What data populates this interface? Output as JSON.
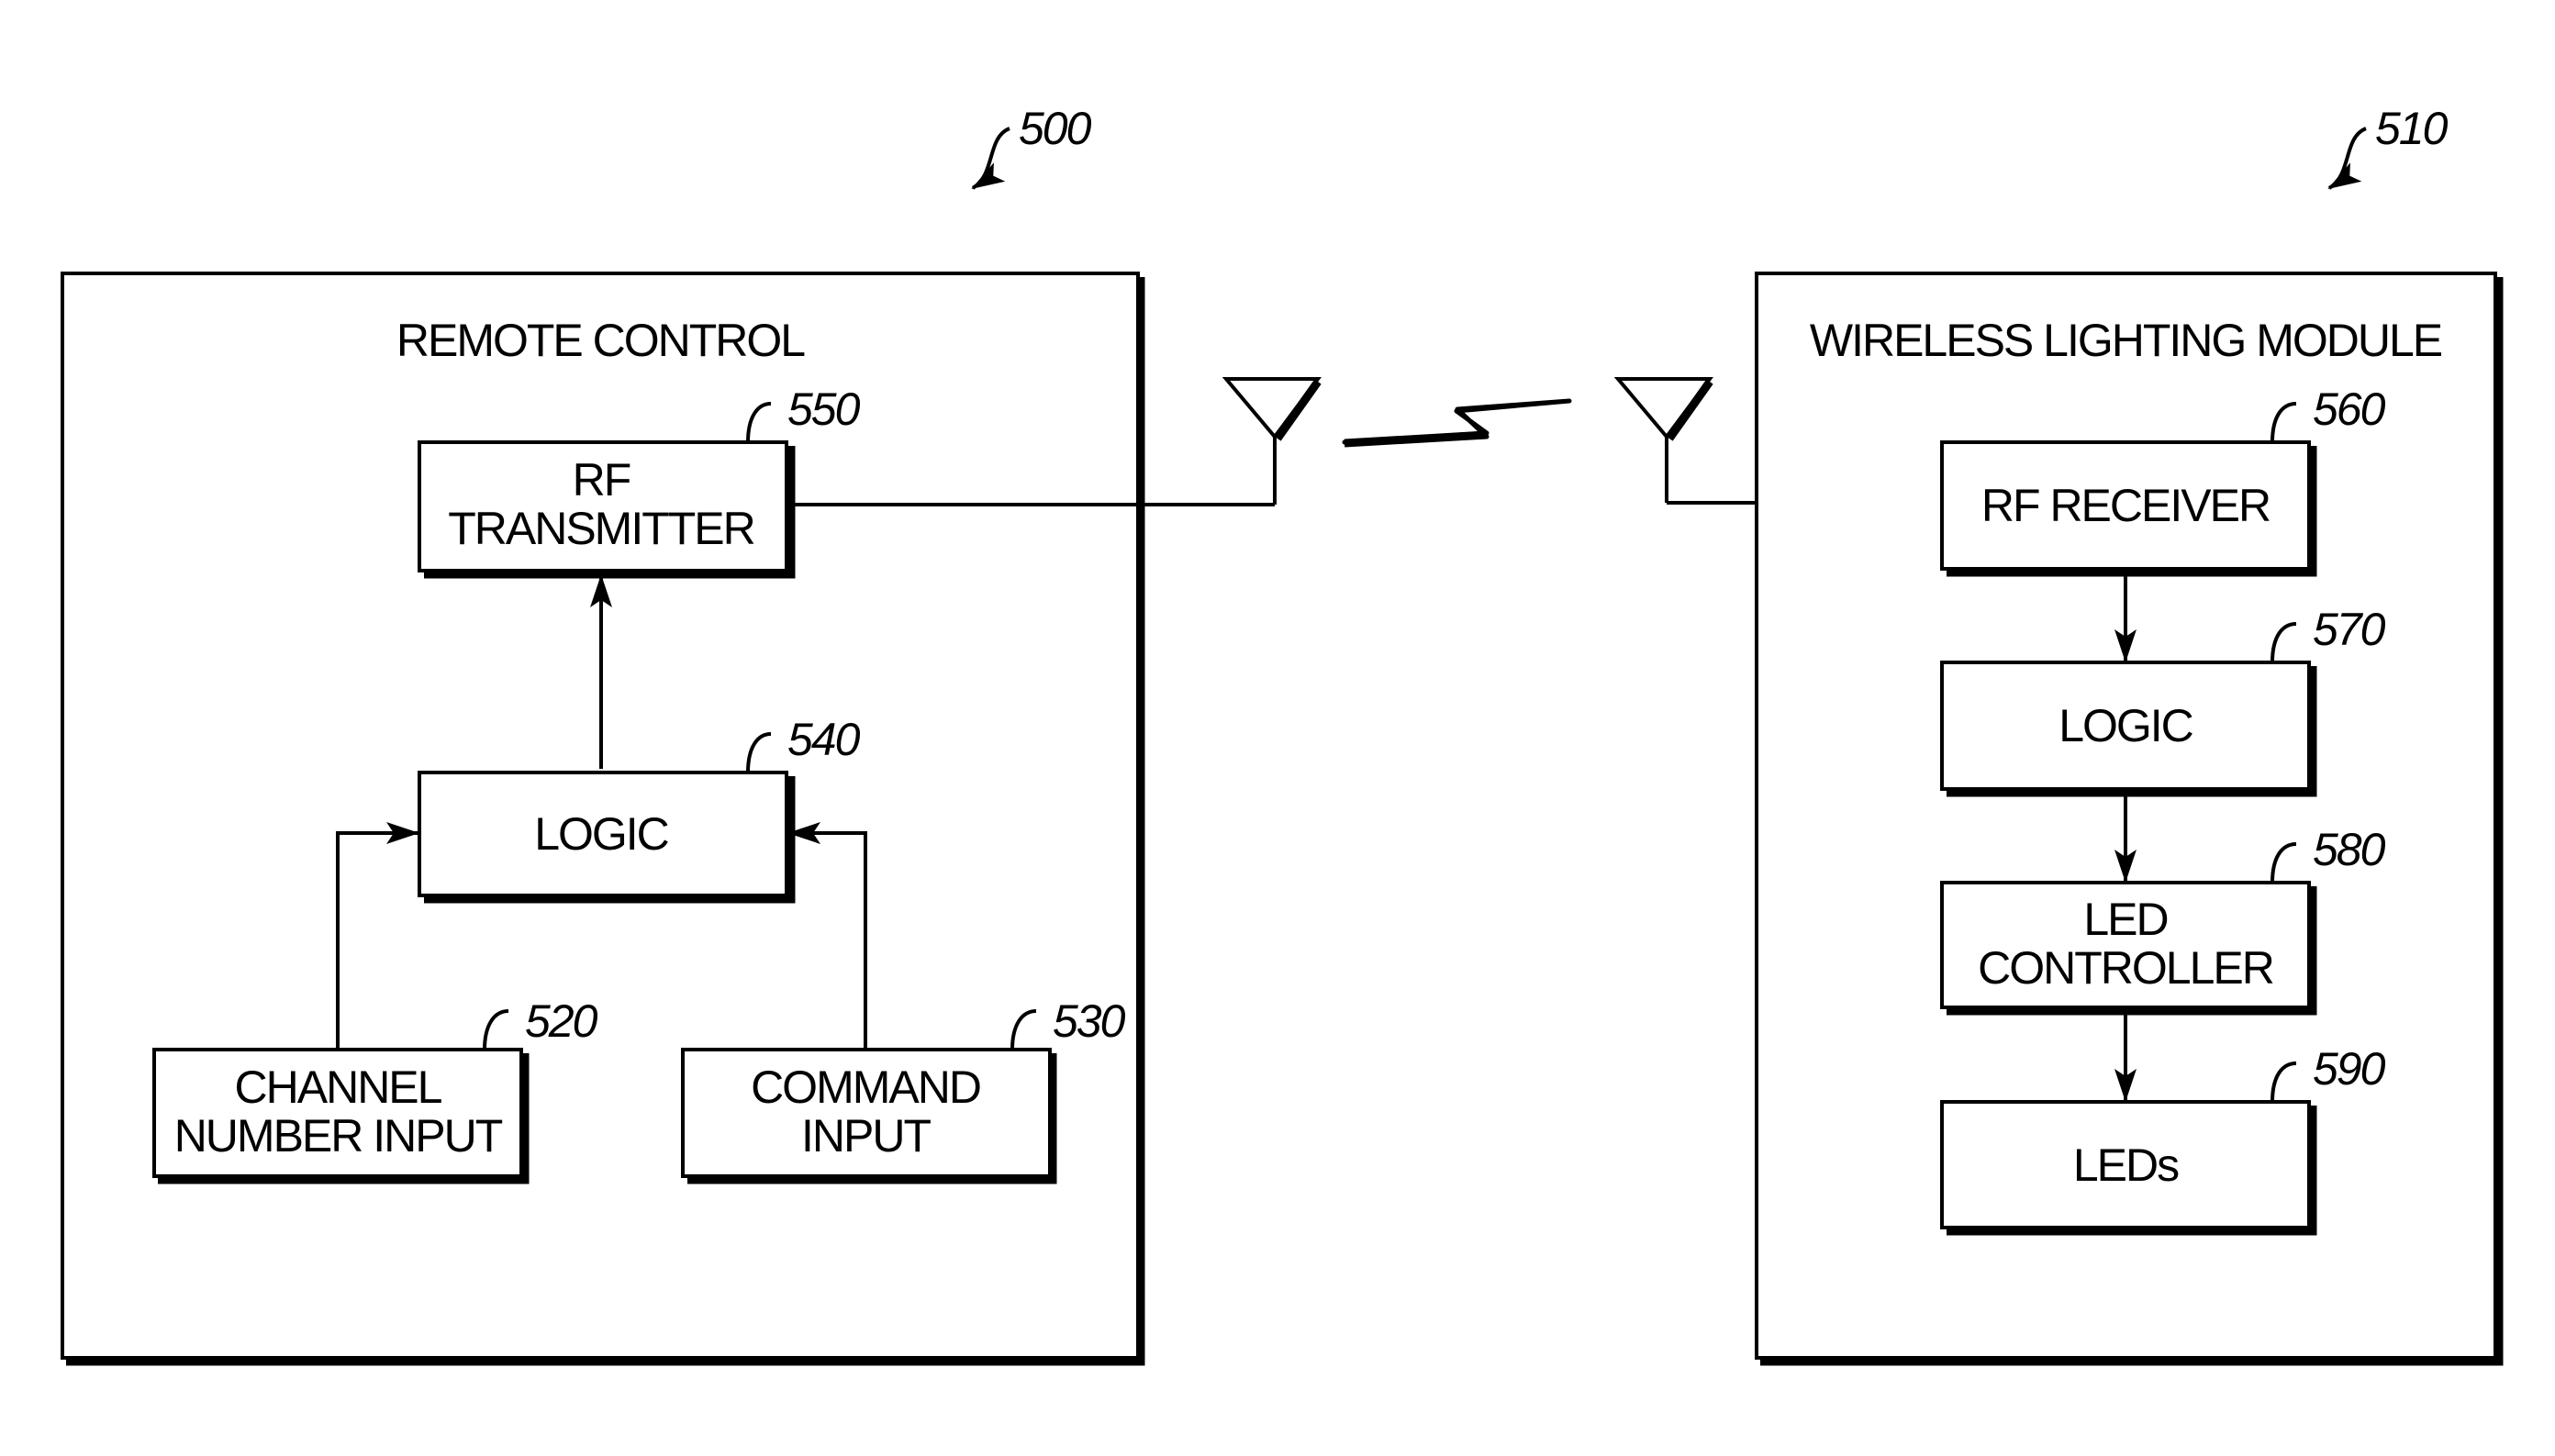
{
  "figure": {
    "left_panel": {
      "ref": "500",
      "title": "REMOTE CONTROL",
      "blocks": [
        {
          "ref": "550",
          "lines": [
            "RF",
            "TRANSMITTER"
          ]
        },
        {
          "ref": "540",
          "lines": [
            "LOGIC"
          ]
        },
        {
          "ref": "520",
          "lines": [
            "CHANNEL",
            "NUMBER INPUT"
          ]
        },
        {
          "ref": "530",
          "lines": [
            "COMMAND",
            "INPUT"
          ]
        }
      ]
    },
    "right_panel": {
      "ref": "510",
      "title": "WIRELESS LIGHTING MODULE",
      "blocks": [
        {
          "ref": "560",
          "lines": [
            "RF RECEIVER"
          ]
        },
        {
          "ref": "570",
          "lines": [
            "LOGIC"
          ]
        },
        {
          "ref": "580",
          "lines": [
            "LED",
            "CONTROLLER"
          ]
        },
        {
          "ref": "590",
          "lines": [
            "LEDs"
          ]
        }
      ]
    },
    "link": {
      "icon": "lightning-bolt-icon",
      "antennas": [
        "antenna-icon",
        "antenna-icon"
      ]
    }
  }
}
